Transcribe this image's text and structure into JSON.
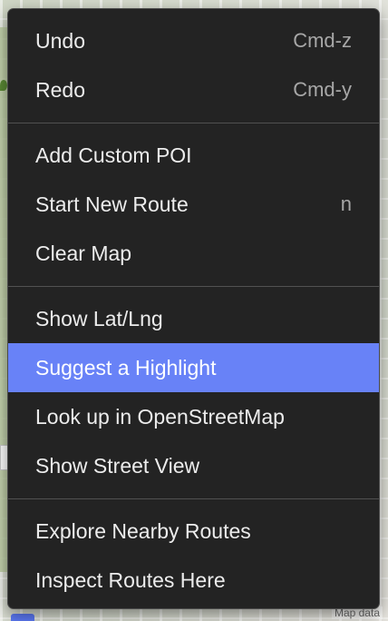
{
  "map": {
    "attribution": "Map data"
  },
  "menu": {
    "groups": [
      [
        {
          "label": "Undo",
          "shortcut": "Cmd-z"
        },
        {
          "label": "Redo",
          "shortcut": "Cmd-y"
        }
      ],
      [
        {
          "label": "Add Custom POI",
          "shortcut": ""
        },
        {
          "label": "Start New Route",
          "shortcut": "n"
        },
        {
          "label": "Clear Map",
          "shortcut": ""
        }
      ],
      [
        {
          "label": "Show Lat/Lng",
          "shortcut": ""
        },
        {
          "label": "Suggest a Highlight",
          "shortcut": ""
        },
        {
          "label": "Look up in OpenStreetMap",
          "shortcut": ""
        },
        {
          "label": "Show Street View",
          "shortcut": ""
        }
      ],
      [
        {
          "label": "Explore Nearby Routes",
          "shortcut": ""
        },
        {
          "label": "Inspect Routes Here",
          "shortcut": ""
        }
      ]
    ],
    "highlighted_item": "Suggest a Highlight"
  },
  "colors": {
    "menu_background": "#232323",
    "highlight": "#6882f7",
    "text": "#ececec",
    "shortcut_text": "#a7a7a7"
  }
}
